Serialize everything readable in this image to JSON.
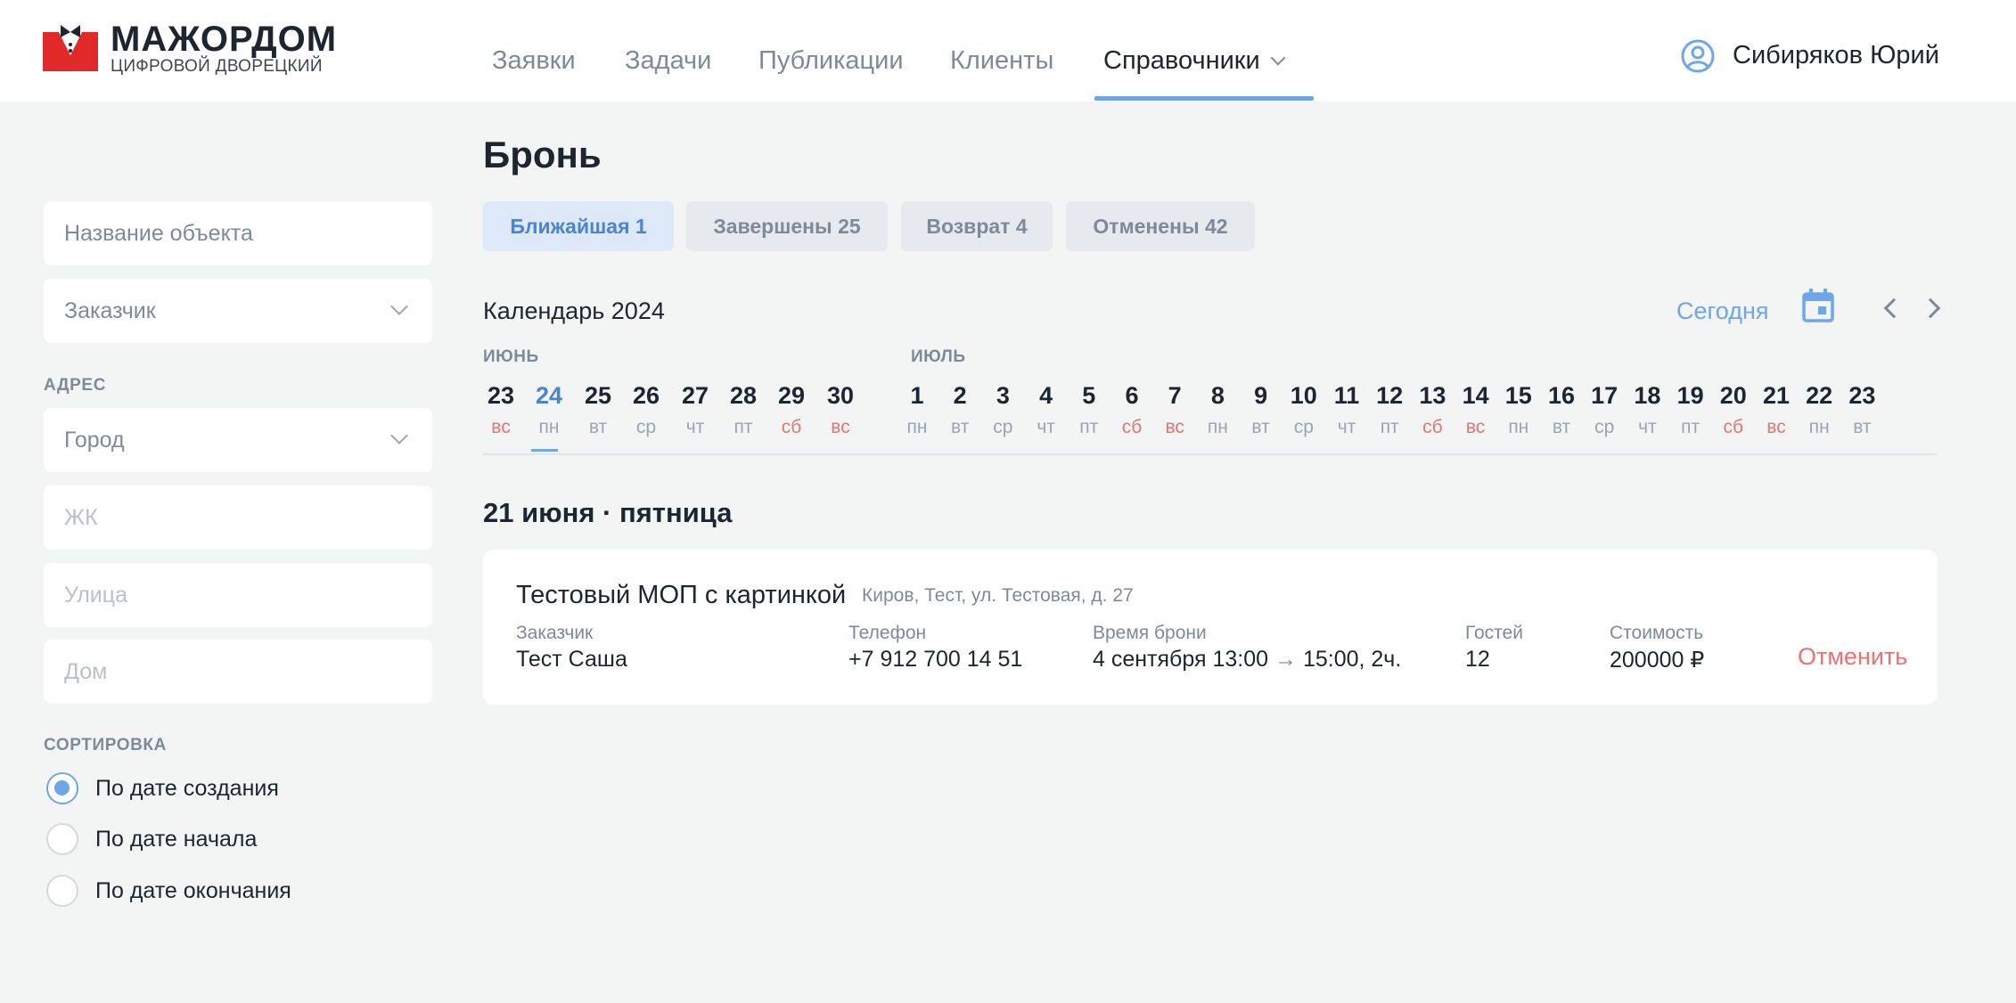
{
  "brand": {
    "title": "МАЖОРДОМ",
    "subtitle": "ЦИФРОВОЙ ДВОРЕЦКИЙ",
    "colors": {
      "red": "#e02a2a",
      "dark": "#1d2530"
    }
  },
  "nav": {
    "items": [
      {
        "label": "Заявки"
      },
      {
        "label": "Задачи"
      },
      {
        "label": "Публикации"
      },
      {
        "label": "Клиенты"
      },
      {
        "label": "Справочники",
        "active": true,
        "has_dropdown": true
      }
    ]
  },
  "user": {
    "name": "Сибиряков Юрий",
    "icon": "user-circle-icon"
  },
  "filters": {
    "object_name_placeholder": "Название объекта",
    "customer_placeholder": "Заказчик",
    "address_label": "АДРЕС",
    "city_placeholder": "Город",
    "complex_placeholder": "ЖК",
    "street_placeholder": "Улица",
    "house_placeholder": "Дом",
    "sort_label": "СОРТИРОВКА",
    "sort_options": [
      {
        "label": "По дате создания",
        "checked": true
      },
      {
        "label": "По дате начала",
        "checked": false
      },
      {
        "label": "По дате окончания",
        "checked": false
      }
    ]
  },
  "page": {
    "title": "Бронь",
    "tabs": [
      {
        "label": "Ближайшая 1",
        "active": true
      },
      {
        "label": "Завершены 25",
        "active": false
      },
      {
        "label": "Возврат 4",
        "active": false
      },
      {
        "label": "Отменены 42",
        "active": false
      }
    ]
  },
  "calendar": {
    "title": "Календарь 2024",
    "today_label": "Сегодня",
    "months": [
      "ИЮНЬ",
      "ИЮЛЬ"
    ],
    "june_days": [
      {
        "num": "23",
        "wd": "вс",
        "weekend": true
      },
      {
        "num": "24",
        "wd": "пн",
        "weekend": false,
        "selected": true
      },
      {
        "num": "25",
        "wd": "вт",
        "weekend": false
      },
      {
        "num": "26",
        "wd": "ср",
        "weekend": false
      },
      {
        "num": "27",
        "wd": "чт",
        "weekend": false
      },
      {
        "num": "28",
        "wd": "пт",
        "weekend": false
      },
      {
        "num": "29",
        "wd": "сб",
        "weekend": true
      },
      {
        "num": "30",
        "wd": "вс",
        "weekend": true
      }
    ],
    "july_days": [
      {
        "num": "1",
        "wd": "пн",
        "weekend": false
      },
      {
        "num": "2",
        "wd": "вт",
        "weekend": false
      },
      {
        "num": "3",
        "wd": "ср",
        "weekend": false
      },
      {
        "num": "4",
        "wd": "чт",
        "weekend": false
      },
      {
        "num": "5",
        "wd": "пт",
        "weekend": false
      },
      {
        "num": "6",
        "wd": "сб",
        "weekend": true
      },
      {
        "num": "7",
        "wd": "вс",
        "weekend": true
      },
      {
        "num": "8",
        "wd": "пн",
        "weekend": false
      },
      {
        "num": "9",
        "wd": "вт",
        "weekend": false
      },
      {
        "num": "10",
        "wd": "ср",
        "weekend": false
      },
      {
        "num": "11",
        "wd": "чт",
        "weekend": false
      },
      {
        "num": "12",
        "wd": "пт",
        "weekend": false
      },
      {
        "num": "13",
        "wd": "сб",
        "weekend": true
      },
      {
        "num": "14",
        "wd": "вс",
        "weekend": true
      },
      {
        "num": "15",
        "wd": "пн",
        "weekend": false
      },
      {
        "num": "16",
        "wd": "вт",
        "weekend": false
      },
      {
        "num": "17",
        "wd": "ср",
        "weekend": false
      },
      {
        "num": "18",
        "wd": "чт",
        "weekend": false
      },
      {
        "num": "19",
        "wd": "пт",
        "weekend": false
      },
      {
        "num": "20",
        "wd": "сб",
        "weekend": true
      },
      {
        "num": "21",
        "wd": "вс",
        "weekend": true
      },
      {
        "num": "22",
        "wd": "пн",
        "weekend": false
      },
      {
        "num": "23",
        "wd": "вт",
        "weekend": false
      }
    ]
  },
  "bookings": {
    "date_heading": "21 июня · пятница",
    "items": [
      {
        "title": "Тестовый МОП с картинкой",
        "address": "Киров, Тест, ул. Тестовая, д. 27",
        "customer_label": "Заказчик",
        "customer": "Тест Саша",
        "phone_label": "Телефон",
        "phone": "+7 912 700 14 51",
        "time_label": "Время брони",
        "time_start": "4 сентября 13:00",
        "time_arrow": "→",
        "time_end": "15:00, 2ч.",
        "guests_label": "Гостей",
        "guests": "12",
        "cost_label": "Стоимость",
        "cost": "200000 ₽",
        "cancel_label": "Отменить"
      }
    ]
  },
  "theme": {
    "accent": "#6fa5ea",
    "danger": "#ea7272",
    "muted": "#7d8a99"
  }
}
